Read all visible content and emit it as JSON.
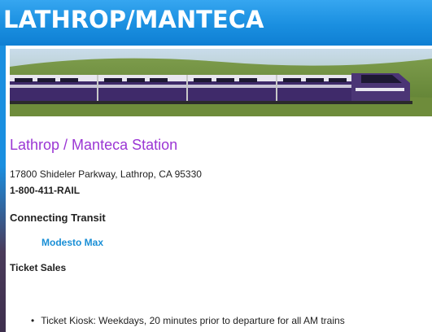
{
  "header": {
    "title": "LATHROP/MANTECA"
  },
  "banner": {
    "alt": "train-photo"
  },
  "station": {
    "name": "Lathrop / Manteca Station",
    "address": "17800 Shideler Parkway, Lathrop, CA 95330",
    "phone": "1-800-411-RAIL"
  },
  "connecting_transit": {
    "heading": "Connecting Transit",
    "links": [
      "Modesto Max"
    ]
  },
  "ticket_sales": {
    "heading": "Ticket Sales",
    "items": [
      "Ticket Kiosk: Weekdays, 20 minutes prior to departure for all AM trains"
    ]
  },
  "colors": {
    "header_blue": "#1a8fe0",
    "station_title_purple": "#9b36d4",
    "link_blue": "#1a8fd6",
    "train_purple": "#3f2a6a"
  }
}
